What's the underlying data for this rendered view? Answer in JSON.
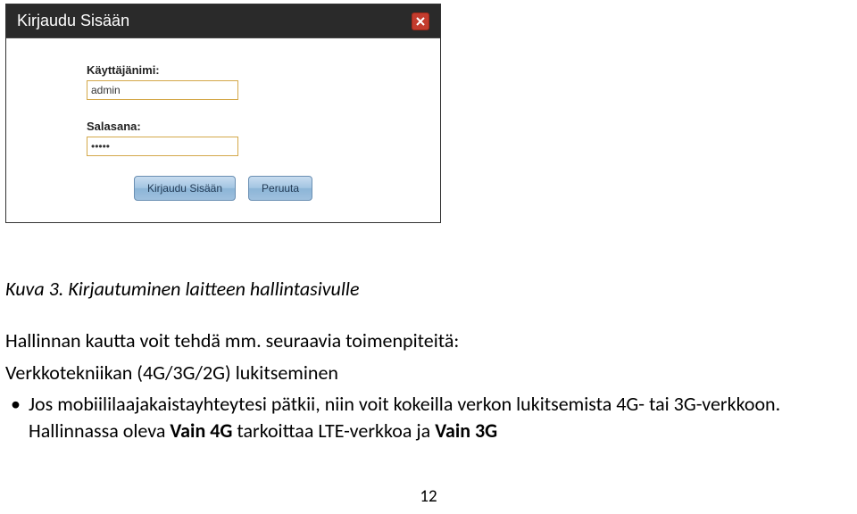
{
  "dialog": {
    "title": "Kirjaudu Sisään",
    "username_label": "Käyttäjänimi:",
    "username_value": "admin",
    "password_label": "Salasana:",
    "password_value": "•••••",
    "login_btn": "Kirjaudu Sisään",
    "cancel_btn": "Peruuta"
  },
  "doc": {
    "caption": "Kuva 3. Kirjautuminen laitteen hallintasivulle",
    "intro": "Hallinnan kautta voit tehdä mm. seuraavia toimenpiteitä:",
    "tech_lock_prefix": "Verkkotekniikan (4G/3G/2G) lukitseminen",
    "bullet1": "Jos mobiililaajakaistayhteytesi pätkii, niin voit kokeilla verkon lukitsemista 4G- tai 3G-verkkoon. Hallinnassa oleva ",
    "vain4g": "Vain 4G",
    "mid": " tarkoittaa LTE-verkkoa ja ",
    "vain3g": "Vain 3G",
    "page_number": "12"
  }
}
